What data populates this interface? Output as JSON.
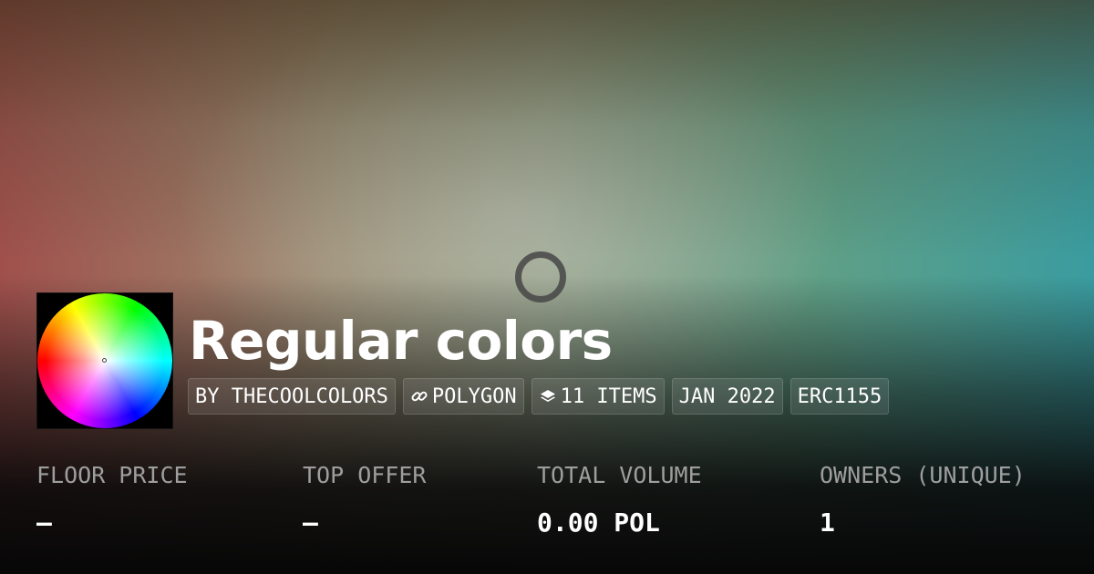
{
  "collection": {
    "name": "Regular colors",
    "logo_icon": "color-wheel-icon",
    "loading_icon": "loading-spinner-icon"
  },
  "tags": [
    {
      "label": "BY THECOOLCOLORS"
    },
    {
      "icon": "link-icon",
      "label": "POLYGON"
    },
    {
      "icon": "layers-icon",
      "label": "11 ITEMS"
    },
    {
      "label": "JAN 2022"
    },
    {
      "label": "ERC1155"
    }
  ],
  "stats": [
    {
      "label": "FLOOR PRICE",
      "value": "–"
    },
    {
      "label": "TOP OFFER",
      "value": "–"
    },
    {
      "label": "TOTAL VOLUME",
      "value": "0.00 POL"
    },
    {
      "label": "OWNERS (UNIQUE)",
      "value": "1"
    }
  ],
  "colors": {
    "text": "#ffffff",
    "muted_text": "#9e9e9e",
    "background_dark": "#070707"
  }
}
